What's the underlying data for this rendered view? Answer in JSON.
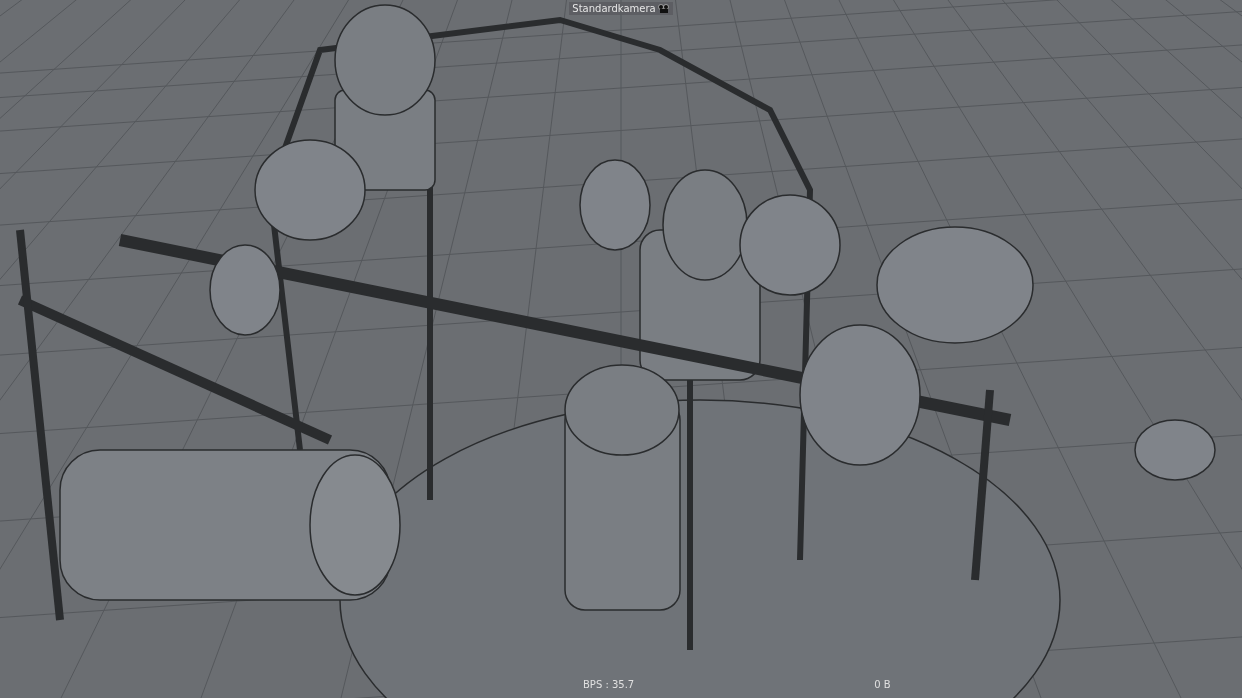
{
  "viewport": {
    "camera": "Standardkamera",
    "hud": {
      "fps": "BPS : 35.7",
      "memory": "0 B"
    }
  }
}
